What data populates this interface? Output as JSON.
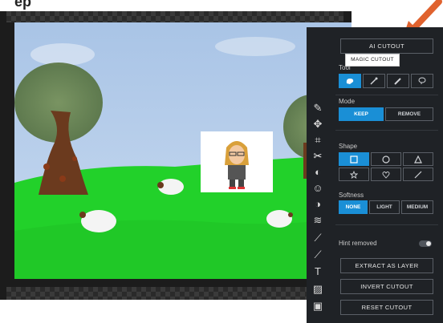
{
  "title_partial": "ep",
  "tooltip": "MAGIC CUTOUT",
  "panel": {
    "ai_cutout": "AI CUTOUT",
    "tool_label": "Tool",
    "mode_label": "Mode",
    "mode_keep": "KEEP",
    "mode_remove": "REMOVE",
    "shape_label": "Shape",
    "softness_label": "Softness",
    "softness_none": "NONE",
    "softness_light": "LIGHT",
    "softness_medium": "MEDIUM",
    "hint_label": "Hint removed",
    "extract": "EXTRACT AS LAYER",
    "invert": "INVERT CUTOUT",
    "reset": "RESET CUTOUT"
  },
  "rail_icons": [
    "edit-icon",
    "move-icon",
    "crop-icon",
    "scissors-icon",
    "adjust-icon",
    "face-icon",
    "color-icon",
    "wave-icon",
    "pen-icon",
    "brush-icon",
    "text-icon",
    "texture-icon",
    "image-icon"
  ],
  "colors": {
    "accent": "#1a8fd6",
    "arrow": "#e0622e",
    "panel_bg": "#1f2226"
  }
}
